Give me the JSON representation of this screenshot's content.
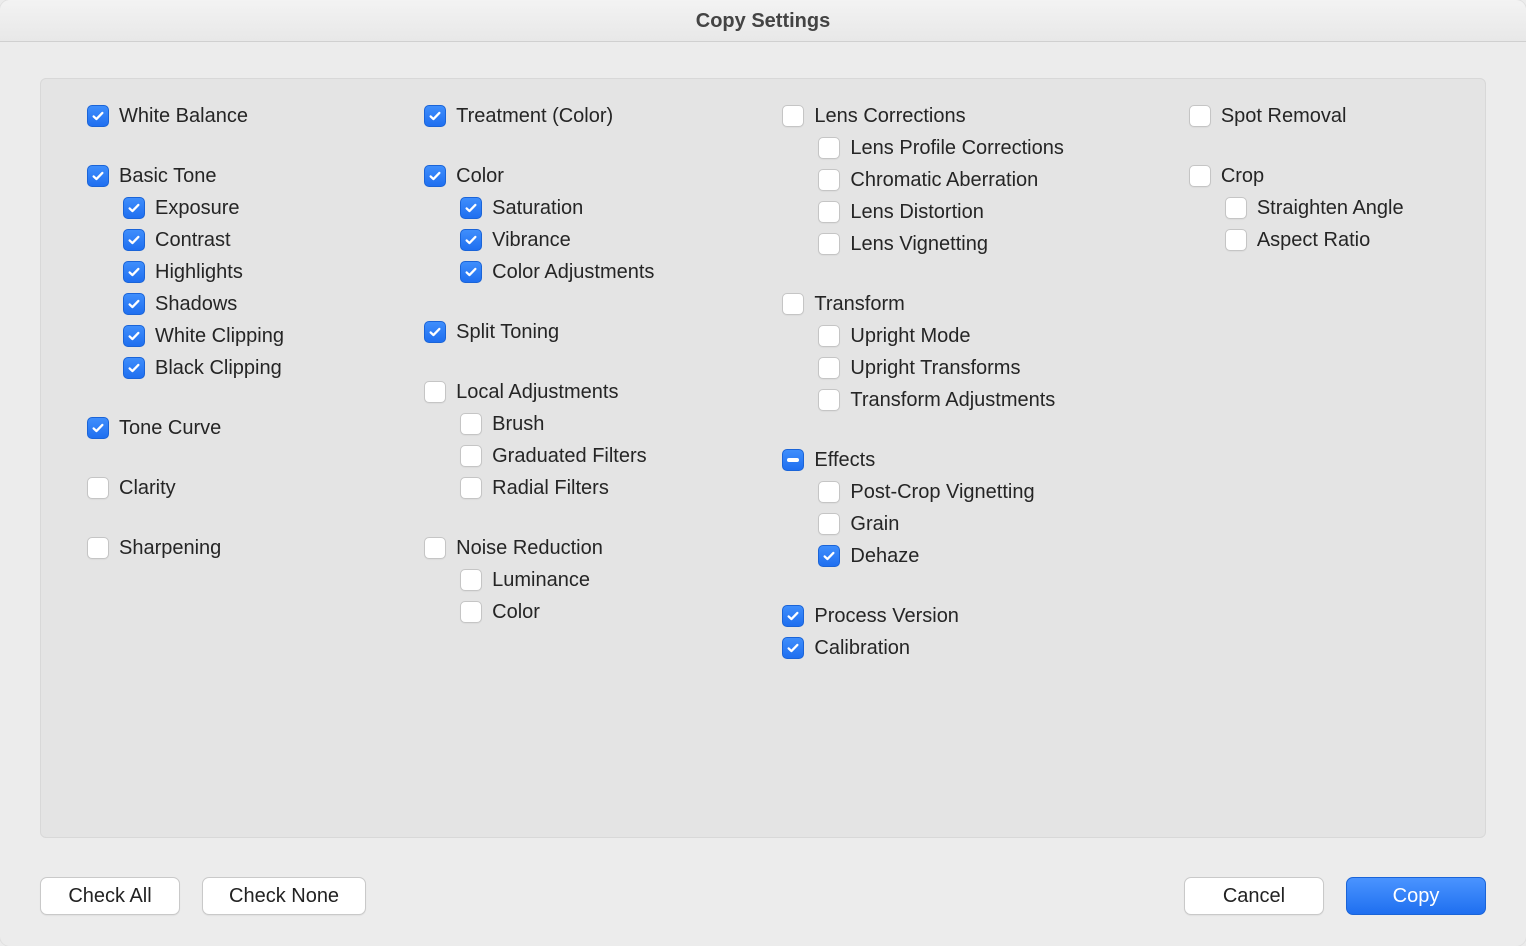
{
  "title": "Copy Settings",
  "columns": [
    [
      {
        "type": "item",
        "state": "checked",
        "label": "White Balance",
        "name": "white-balance"
      },
      {
        "type": "spacer"
      },
      {
        "type": "item",
        "state": "checked",
        "label": "Basic Tone",
        "name": "basic-tone"
      },
      {
        "type": "sub",
        "state": "checked",
        "label": "Exposure",
        "name": "exposure"
      },
      {
        "type": "sub",
        "state": "checked",
        "label": "Contrast",
        "name": "contrast"
      },
      {
        "type": "sub",
        "state": "checked",
        "label": "Highlights",
        "name": "highlights"
      },
      {
        "type": "sub",
        "state": "checked",
        "label": "Shadows",
        "name": "shadows"
      },
      {
        "type": "sub",
        "state": "checked",
        "label": "White Clipping",
        "name": "white-clipping"
      },
      {
        "type": "sub",
        "state": "checked",
        "label": "Black Clipping",
        "name": "black-clipping"
      },
      {
        "type": "spacer"
      },
      {
        "type": "item",
        "state": "checked",
        "label": "Tone Curve",
        "name": "tone-curve"
      },
      {
        "type": "spacer"
      },
      {
        "type": "item",
        "state": "unchecked",
        "label": "Clarity",
        "name": "clarity"
      },
      {
        "type": "spacer"
      },
      {
        "type": "item",
        "state": "unchecked",
        "label": "Sharpening",
        "name": "sharpening"
      }
    ],
    [
      {
        "type": "item",
        "state": "checked",
        "label": "Treatment (Color)",
        "name": "treatment-color"
      },
      {
        "type": "spacer"
      },
      {
        "type": "item",
        "state": "checked",
        "label": "Color",
        "name": "color"
      },
      {
        "type": "sub",
        "state": "checked",
        "label": "Saturation",
        "name": "saturation"
      },
      {
        "type": "sub",
        "state": "checked",
        "label": "Vibrance",
        "name": "vibrance"
      },
      {
        "type": "sub",
        "state": "checked",
        "label": "Color Adjustments",
        "name": "color-adjustments"
      },
      {
        "type": "spacer"
      },
      {
        "type": "item",
        "state": "checked",
        "label": "Split Toning",
        "name": "split-toning"
      },
      {
        "type": "spacer"
      },
      {
        "type": "item",
        "state": "unchecked",
        "label": "Local Adjustments",
        "name": "local-adjustments"
      },
      {
        "type": "sub",
        "state": "unchecked",
        "label": "Brush",
        "name": "brush"
      },
      {
        "type": "sub",
        "state": "unchecked",
        "label": "Graduated Filters",
        "name": "graduated-filters"
      },
      {
        "type": "sub",
        "state": "unchecked",
        "label": "Radial Filters",
        "name": "radial-filters"
      },
      {
        "type": "spacer"
      },
      {
        "type": "item",
        "state": "unchecked",
        "label": "Noise Reduction",
        "name": "noise-reduction"
      },
      {
        "type": "sub",
        "state": "unchecked",
        "label": "Luminance",
        "name": "luminance"
      },
      {
        "type": "sub",
        "state": "unchecked",
        "label": "Color",
        "name": "noise-color"
      }
    ],
    [
      {
        "type": "item",
        "state": "unchecked",
        "label": "Lens Corrections",
        "name": "lens-corrections"
      },
      {
        "type": "sub",
        "state": "unchecked",
        "label": "Lens Profile Corrections",
        "name": "lens-profile-corrections"
      },
      {
        "type": "sub",
        "state": "unchecked",
        "label": "Chromatic Aberration",
        "name": "chromatic-aberration"
      },
      {
        "type": "sub",
        "state": "unchecked",
        "label": "Lens Distortion",
        "name": "lens-distortion"
      },
      {
        "type": "sub",
        "state": "unchecked",
        "label": "Lens Vignetting",
        "name": "lens-vignetting"
      },
      {
        "type": "spacer"
      },
      {
        "type": "item",
        "state": "unchecked",
        "label": "Transform",
        "name": "transform"
      },
      {
        "type": "sub",
        "state": "unchecked",
        "label": "Upright Mode",
        "name": "upright-mode"
      },
      {
        "type": "sub",
        "state": "unchecked",
        "label": "Upright Transforms",
        "name": "upright-transforms"
      },
      {
        "type": "sub",
        "state": "unchecked",
        "label": "Transform Adjustments",
        "name": "transform-adjustments"
      },
      {
        "type": "spacer"
      },
      {
        "type": "item",
        "state": "mixed",
        "label": "Effects",
        "name": "effects"
      },
      {
        "type": "sub",
        "state": "unchecked",
        "label": "Post-Crop Vignetting",
        "name": "post-crop-vignetting"
      },
      {
        "type": "sub",
        "state": "unchecked",
        "label": "Grain",
        "name": "grain"
      },
      {
        "type": "sub",
        "state": "checked",
        "label": "Dehaze",
        "name": "dehaze"
      },
      {
        "type": "spacer"
      },
      {
        "type": "item",
        "state": "checked",
        "label": "Process Version",
        "name": "process-version"
      },
      {
        "type": "item",
        "state": "checked",
        "label": "Calibration",
        "name": "calibration"
      }
    ],
    [
      {
        "type": "item",
        "state": "unchecked",
        "label": "Spot Removal",
        "name": "spot-removal"
      },
      {
        "type": "spacer"
      },
      {
        "type": "item",
        "state": "unchecked",
        "label": "Crop",
        "name": "crop"
      },
      {
        "type": "sub",
        "state": "unchecked",
        "label": "Straighten Angle",
        "name": "straighten-angle"
      },
      {
        "type": "sub",
        "state": "unchecked",
        "label": "Aspect Ratio",
        "name": "aspect-ratio"
      }
    ]
  ],
  "buttons": {
    "check_all": "Check All",
    "check_none": "Check None",
    "cancel": "Cancel",
    "copy": "Copy"
  }
}
